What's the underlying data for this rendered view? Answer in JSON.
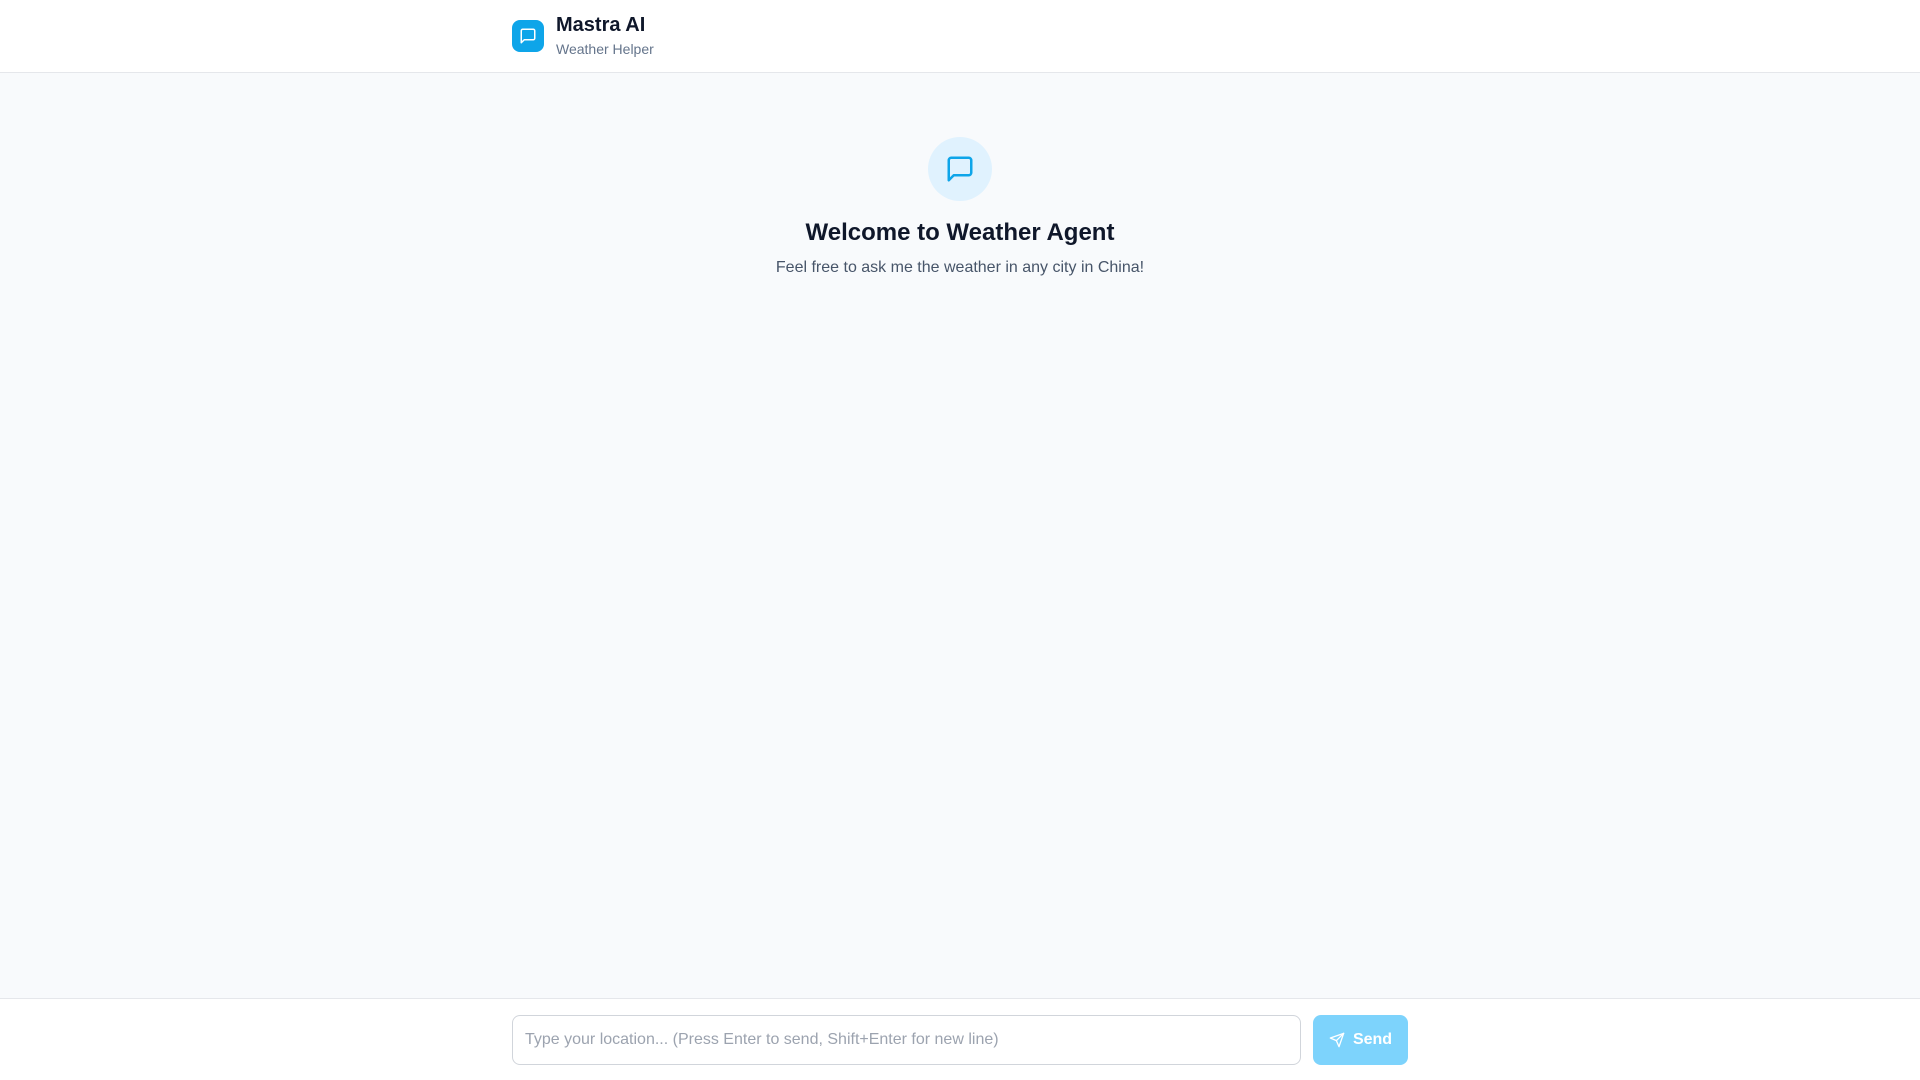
{
  "header": {
    "title": "Mastra AI",
    "subtitle": "Weather Helper",
    "logo_icon": "chat-bubble-icon"
  },
  "welcome": {
    "icon": "chat-bubble-icon",
    "title": "Welcome to Weather Agent",
    "subtitle": "Feel free to ask me the weather in any city in China!"
  },
  "composer": {
    "placeholder": "Type your location... (Press Enter to send, Shift+Enter for new line)",
    "value": "",
    "send_label": "Send",
    "send_icon": "send-icon"
  },
  "colors": {
    "accent": "#0ea5e9",
    "accent_light": "#e0f2fe",
    "send_disabled": "#7dd3fc",
    "background": "#f8fafc"
  }
}
